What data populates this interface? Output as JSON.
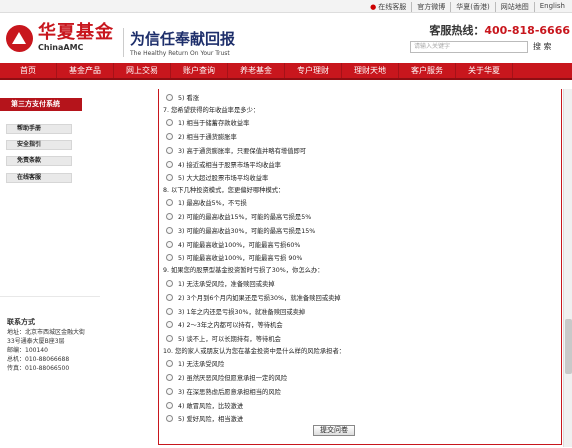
{
  "topbar": {
    "links": [
      "在线客服",
      "官方微博",
      "华夏(香港)",
      "网站地图",
      "English"
    ]
  },
  "header": {
    "logo_cn": "华夏基金",
    "logo_en": "ChinaAMC",
    "slogan_cn": "为信任奉献回报",
    "slogan_en": "The Healthy Return On Your Trust",
    "hotline_label": "客服热线：",
    "hotline_number": "400-818-6666",
    "search_placeholder": "请输入关键字",
    "search_button": "搜 索"
  },
  "nav": [
    "首页",
    "基金产品",
    "网上交易",
    "账户查询",
    "养老基金",
    "专户理财",
    "理财天地",
    "客户服务",
    "关于华夏"
  ],
  "sidebar": {
    "title": "第三方支付系统",
    "items": [
      "帮助手册",
      "安全指引",
      "免责条款",
      "在线客服"
    ],
    "contact_title": "联系方式",
    "contact_lines": [
      "地址：北京市西城区金融大街",
      "33号通泰大厦B座3层",
      "邮编：100140",
      "总机：010-88066688",
      "传真：010-88066500"
    ]
  },
  "questions": [
    {
      "title": "",
      "options": [
        "5) 看涨"
      ]
    },
    {
      "title": "7. 您希望获得的年收益率是多少：",
      "options": [
        "1) 相当于储蓄存款收益率",
        "2) 相当于通货膨胀率",
        "3) 高于通货膨胀率，只要保值并略有增值即可",
        "4) 接近或相当于股票市场平均收益率",
        "5) 大大超过股票市场平均收益率"
      ]
    },
    {
      "title": "8. 以下几种投资模式，您更偏好哪种模式：",
      "options": [
        "1) 最高收益5%，不亏损",
        "2) 可能的最高收益15%，可能的最高亏损是5%",
        "3) 可能的最高收益30%，可能的最高亏损是15%",
        "4) 可能最高收益100%，可能最高亏损60%",
        "5) 可能最高收益100%，可能最高亏损 90%"
      ]
    },
    {
      "title": "9. 如果您的股票型基金投资暂时亏损了30%，你怎么办：",
      "options": [
        "1) 无法承受风险，准备赎回或卖掉",
        "2) 3个月到6个月内如果还是亏损30%，就准备赎回或卖掉",
        "3) 1年之内还是亏损30%，就准备赎回或卖掉",
        "4) 2～3年之内都可以持有，等待机会",
        "5) 谈不上，可以长期持有，等待机会"
      ]
    },
    {
      "title": "10. 您的家人或朋友认为您在基金投资中是什么样的风险承担者：",
      "options": [
        "1) 无法承受风险",
        "2) 虽然厌恶风险但愿意承担一定的风险",
        "3) 在深思熟虑后愿意承担相当的风险",
        "4) 敢冒风险，比较激进",
        "5) 爱好风险，相当激进"
      ]
    }
  ],
  "submit_label": "提交问卷"
}
